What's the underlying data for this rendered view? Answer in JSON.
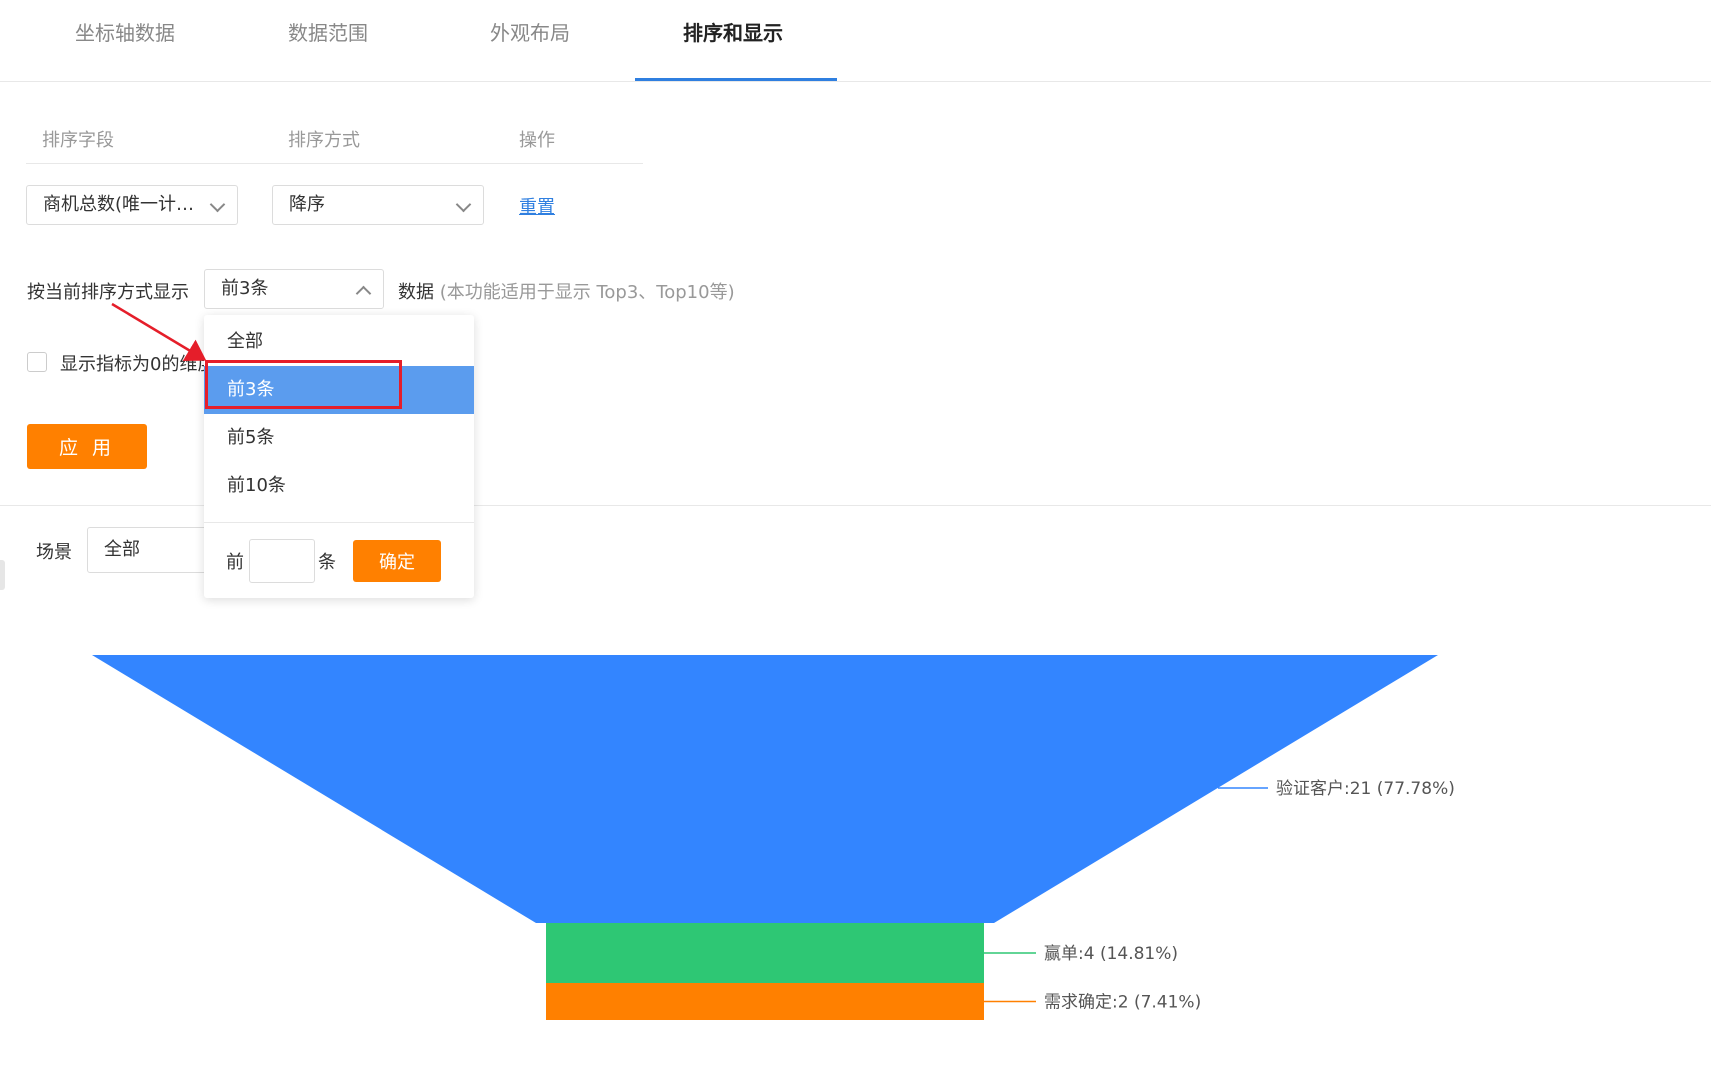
{
  "tabs": [
    {
      "label": "坐标轴数据"
    },
    {
      "label": "数据范围"
    },
    {
      "label": "外观布局"
    },
    {
      "label": "排序和显示"
    }
  ],
  "sort": {
    "headers": {
      "field": "排序字段",
      "method": "排序方式",
      "action": "操作"
    },
    "field_value": "商机总数(唯一计…",
    "method_value": "降序",
    "reset_label": "重置"
  },
  "display": {
    "prefix": "按当前排序方式显示",
    "selected": "前3条",
    "suffix_main": "数据",
    "suffix_hint": "(本功能适用于显示 Top3、Top10等)"
  },
  "dropdown": {
    "options": [
      "全部",
      "前3条",
      "前5条",
      "前10条"
    ],
    "selected_index": 1,
    "custom_prefix": "前",
    "custom_value": "",
    "custom_suffix": "条",
    "ok_label": "确定"
  },
  "zero_checkbox": {
    "label": "显示指标为0的维度",
    "checked": false
  },
  "apply_label": "应 用",
  "scene": {
    "label": "场景",
    "value": "全部"
  },
  "chart_data": {
    "type": "funnel",
    "categories": [
      "验证客户",
      "赢单",
      "需求确定"
    ],
    "values": [
      21,
      4,
      2
    ],
    "percents": [
      "77.78%",
      "14.81%",
      "7.41%"
    ],
    "labels": [
      "验证客户:21 (77.78%)",
      "赢单:4 (14.81%)",
      "需求确定:2 (7.41%)"
    ],
    "colors": [
      "#3385ff",
      "#2ec774",
      "#ff8000"
    ]
  }
}
